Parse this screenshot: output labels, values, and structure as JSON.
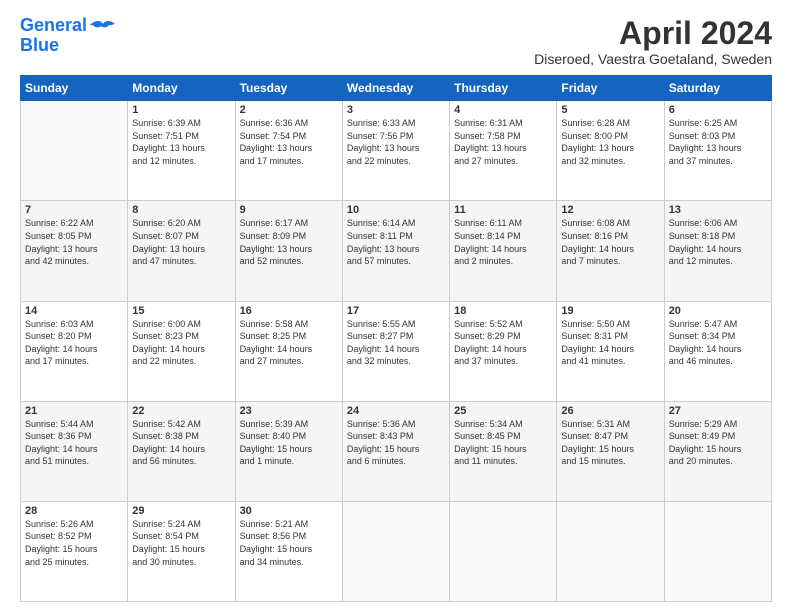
{
  "header": {
    "logo_line1": "General",
    "logo_line2": "Blue",
    "month_title": "April 2024",
    "subtitle": "Diseroed, Vaestra Goetaland, Sweden"
  },
  "days_of_week": [
    "Sunday",
    "Monday",
    "Tuesday",
    "Wednesday",
    "Thursday",
    "Friday",
    "Saturday"
  ],
  "weeks": [
    [
      {
        "day": "",
        "info": ""
      },
      {
        "day": "1",
        "info": "Sunrise: 6:39 AM\nSunset: 7:51 PM\nDaylight: 13 hours\nand 12 minutes."
      },
      {
        "day": "2",
        "info": "Sunrise: 6:36 AM\nSunset: 7:54 PM\nDaylight: 13 hours\nand 17 minutes."
      },
      {
        "day": "3",
        "info": "Sunrise: 6:33 AM\nSunset: 7:56 PM\nDaylight: 13 hours\nand 22 minutes."
      },
      {
        "day": "4",
        "info": "Sunrise: 6:31 AM\nSunset: 7:58 PM\nDaylight: 13 hours\nand 27 minutes."
      },
      {
        "day": "5",
        "info": "Sunrise: 6:28 AM\nSunset: 8:00 PM\nDaylight: 13 hours\nand 32 minutes."
      },
      {
        "day": "6",
        "info": "Sunrise: 6:25 AM\nSunset: 8:03 PM\nDaylight: 13 hours\nand 37 minutes."
      }
    ],
    [
      {
        "day": "7",
        "info": "Sunrise: 6:22 AM\nSunset: 8:05 PM\nDaylight: 13 hours\nand 42 minutes."
      },
      {
        "day": "8",
        "info": "Sunrise: 6:20 AM\nSunset: 8:07 PM\nDaylight: 13 hours\nand 47 minutes."
      },
      {
        "day": "9",
        "info": "Sunrise: 6:17 AM\nSunset: 8:09 PM\nDaylight: 13 hours\nand 52 minutes."
      },
      {
        "day": "10",
        "info": "Sunrise: 6:14 AM\nSunset: 8:11 PM\nDaylight: 13 hours\nand 57 minutes."
      },
      {
        "day": "11",
        "info": "Sunrise: 6:11 AM\nSunset: 8:14 PM\nDaylight: 14 hours\nand 2 minutes."
      },
      {
        "day": "12",
        "info": "Sunrise: 6:08 AM\nSunset: 8:16 PM\nDaylight: 14 hours\nand 7 minutes."
      },
      {
        "day": "13",
        "info": "Sunrise: 6:06 AM\nSunset: 8:18 PM\nDaylight: 14 hours\nand 12 minutes."
      }
    ],
    [
      {
        "day": "14",
        "info": "Sunrise: 6:03 AM\nSunset: 8:20 PM\nDaylight: 14 hours\nand 17 minutes."
      },
      {
        "day": "15",
        "info": "Sunrise: 6:00 AM\nSunset: 8:23 PM\nDaylight: 14 hours\nand 22 minutes."
      },
      {
        "day": "16",
        "info": "Sunrise: 5:58 AM\nSunset: 8:25 PM\nDaylight: 14 hours\nand 27 minutes."
      },
      {
        "day": "17",
        "info": "Sunrise: 5:55 AM\nSunset: 8:27 PM\nDaylight: 14 hours\nand 32 minutes."
      },
      {
        "day": "18",
        "info": "Sunrise: 5:52 AM\nSunset: 8:29 PM\nDaylight: 14 hours\nand 37 minutes."
      },
      {
        "day": "19",
        "info": "Sunrise: 5:50 AM\nSunset: 8:31 PM\nDaylight: 14 hours\nand 41 minutes."
      },
      {
        "day": "20",
        "info": "Sunrise: 5:47 AM\nSunset: 8:34 PM\nDaylight: 14 hours\nand 46 minutes."
      }
    ],
    [
      {
        "day": "21",
        "info": "Sunrise: 5:44 AM\nSunset: 8:36 PM\nDaylight: 14 hours\nand 51 minutes."
      },
      {
        "day": "22",
        "info": "Sunrise: 5:42 AM\nSunset: 8:38 PM\nDaylight: 14 hours\nand 56 minutes."
      },
      {
        "day": "23",
        "info": "Sunrise: 5:39 AM\nSunset: 8:40 PM\nDaylight: 15 hours\nand 1 minute."
      },
      {
        "day": "24",
        "info": "Sunrise: 5:36 AM\nSunset: 8:43 PM\nDaylight: 15 hours\nand 6 minutes."
      },
      {
        "day": "25",
        "info": "Sunrise: 5:34 AM\nSunset: 8:45 PM\nDaylight: 15 hours\nand 11 minutes."
      },
      {
        "day": "26",
        "info": "Sunrise: 5:31 AM\nSunset: 8:47 PM\nDaylight: 15 hours\nand 15 minutes."
      },
      {
        "day": "27",
        "info": "Sunrise: 5:29 AM\nSunset: 8:49 PM\nDaylight: 15 hours\nand 20 minutes."
      }
    ],
    [
      {
        "day": "28",
        "info": "Sunrise: 5:26 AM\nSunset: 8:52 PM\nDaylight: 15 hours\nand 25 minutes."
      },
      {
        "day": "29",
        "info": "Sunrise: 5:24 AM\nSunset: 8:54 PM\nDaylight: 15 hours\nand 30 minutes."
      },
      {
        "day": "30",
        "info": "Sunrise: 5:21 AM\nSunset: 8:56 PM\nDaylight: 15 hours\nand 34 minutes."
      },
      {
        "day": "",
        "info": ""
      },
      {
        "day": "",
        "info": ""
      },
      {
        "day": "",
        "info": ""
      },
      {
        "day": "",
        "info": ""
      }
    ]
  ]
}
